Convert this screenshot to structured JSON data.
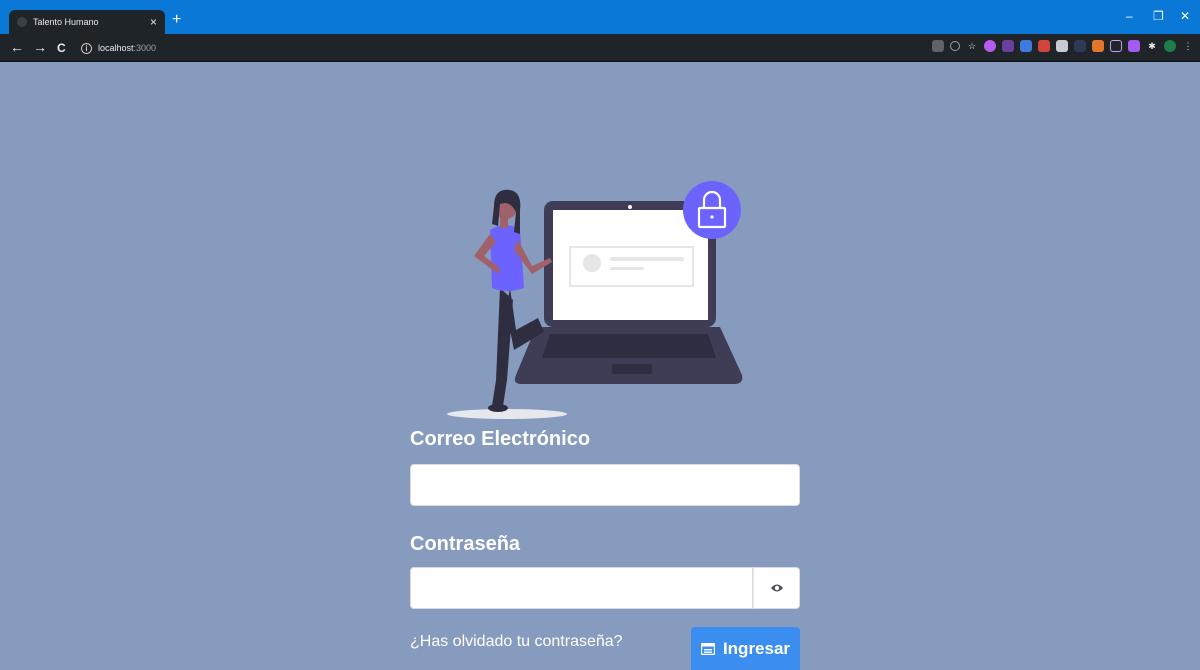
{
  "browser": {
    "tab_title": "Talento Humano",
    "tab_close": "×",
    "new_tab": "+",
    "window_controls": {
      "minimize": "–",
      "restore": "❐",
      "close": "✕"
    },
    "nav": {
      "back": "←",
      "forward": "→",
      "reload": "C"
    },
    "url_host": "localhost",
    "url_port": ":3000"
  },
  "form": {
    "email_label": "Correo Electrónico",
    "email_value": "",
    "password_label": "Contraseña",
    "password_value": "",
    "forgot_link": "¿Has olvidado tu contraseña?",
    "login_button": "Ingresar"
  },
  "colors": {
    "background": "#869bbd",
    "accent": "#3b8ef0",
    "illustration_purple": "#6c63ff",
    "browser_titlebar": "#0a78d7"
  },
  "icons": {
    "show_password": "eye-icon",
    "login": "login-card-icon",
    "illustration": "person-with-laptop-lock"
  }
}
